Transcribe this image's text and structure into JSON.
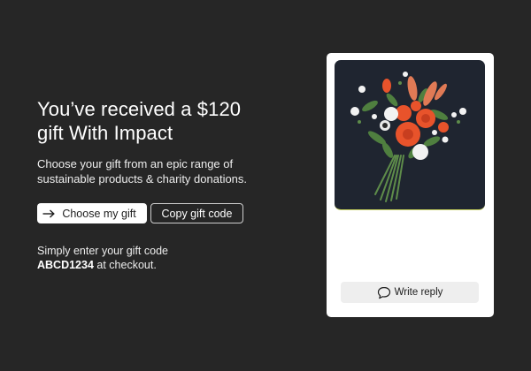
{
  "gift": {
    "title_line1": "You’ve received a $120",
    "title_line2": "gift With Impact",
    "subtitle_line1": "Choose your gift from an epic range of",
    "subtitle_line2": "sustainable products & charity donations.",
    "choose_label": "Choose my gift",
    "copy_label": "Copy gift code",
    "note_line1": "Simply enter your gift code",
    "code": "ABCD1234",
    "note_suffix": " at checkout."
  },
  "card": {
    "image_description_icon": "bouquet-illustration",
    "reply_label": "Write reply",
    "reply_icon": "speech-bubble-icon"
  },
  "colors": {
    "background": "#262626",
    "card_bg": "#ffffff",
    "image_bg": "#1f2530",
    "flower_red": "#e8532b",
    "leaf_green": "#4f7f3f"
  }
}
